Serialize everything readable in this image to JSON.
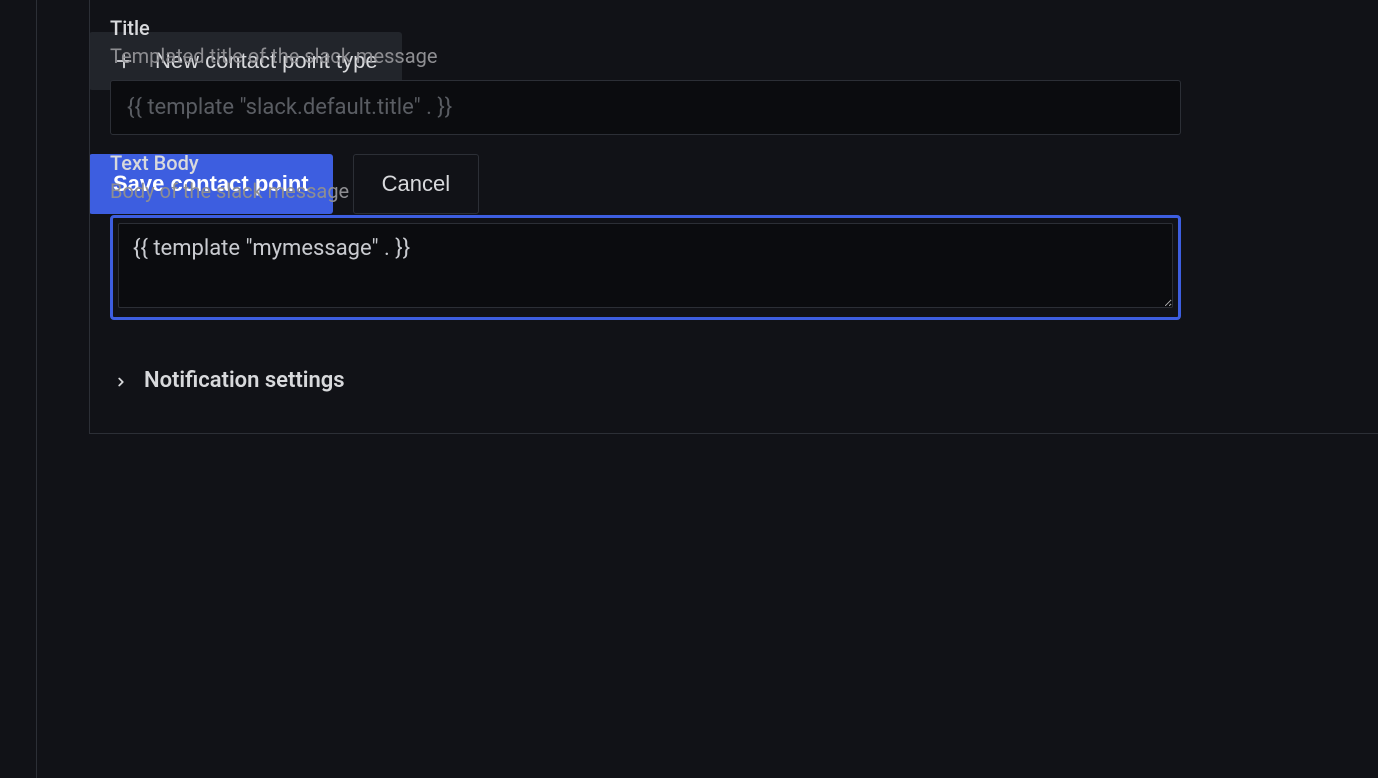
{
  "fields": {
    "title": {
      "label": "Title",
      "description": "Templated title of the slack message",
      "placeholder": "{{ template \"slack.default.title\" . }}"
    },
    "textBody": {
      "label": "Text Body",
      "description": "Body of the slack message",
      "value": "{{ template \"mymessage\" . }}"
    }
  },
  "collapsible": {
    "notificationSettings": "Notification settings"
  },
  "buttons": {
    "newContactPointType": "New contact point type",
    "saveContactPoint": "Save contact point",
    "cancel": "Cancel"
  }
}
